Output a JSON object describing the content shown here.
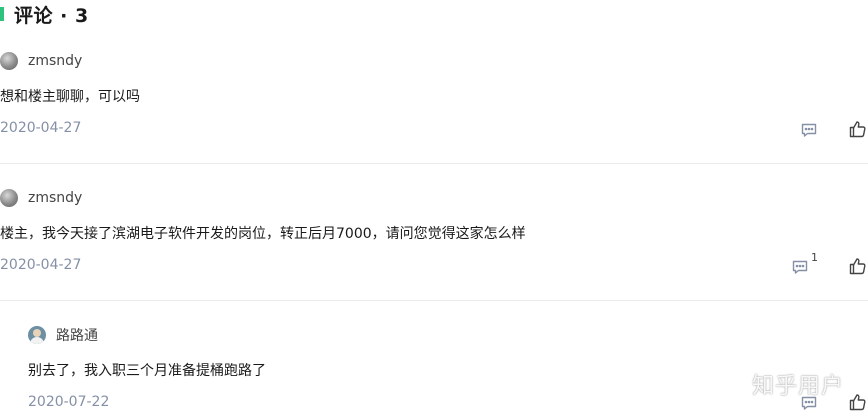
{
  "section": {
    "title": "评论 · 3"
  },
  "comments": [
    {
      "author": "zmsndy",
      "text": "想和楼主聊聊，可以吗",
      "date": "2020-04-27"
    },
    {
      "author": "zmsndy",
      "text": "楼主，我今天接了滨湖电子软件开发的岗位，转正后月7000，请问您觉得这家怎么样",
      "date": "2020-04-27",
      "reply_count": "1"
    },
    {
      "author": "路路通",
      "text": "别去了，我入职三个月准备提桶跑路了",
      "date": "2020-07-22"
    }
  ],
  "watermark": "知乎用户",
  "colors": {
    "accent": "#2ec27e",
    "meta_text": "#8590a6",
    "divider": "#ebebeb"
  },
  "icons": [
    "comment-icon",
    "like-icon"
  ]
}
